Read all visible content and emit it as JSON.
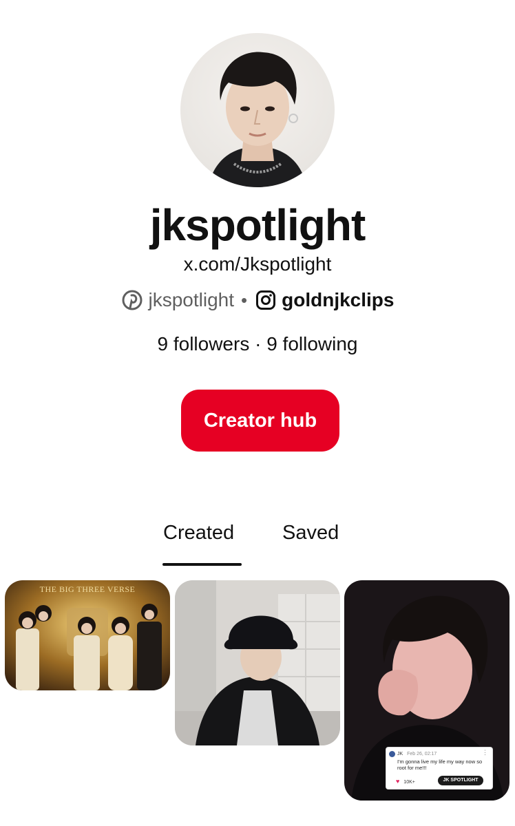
{
  "profile": {
    "username": "jkspotlight",
    "website": "x.com/Jkspotlight",
    "pinterest_handle": "jkspotlight",
    "separator": "•",
    "instagram_handle": "goldnjkclips",
    "follow_stats": "9 followers · 9 following"
  },
  "actions": {
    "creator_hub_label": "Creator hub"
  },
  "tabs": [
    {
      "label": "Created",
      "active": true
    },
    {
      "label": "Saved",
      "active": false
    }
  ],
  "pins": [
    {
      "title_text": "THE BIG THREE VERSE"
    },
    {},
    {
      "comment": {
        "author": "JK",
        "date": "Feb 26, 02:17",
        "text": "I'm gonna live my life my way now so root for me!!!",
        "likes": "10K+"
      },
      "badge": "JK SPOTLIGHT"
    }
  ],
  "colors": {
    "accent": "#e60023",
    "text_primary": "#111111",
    "text_secondary": "#5f5f5f",
    "background": "#ffffff"
  },
  "icons": {
    "pinterest": "pinterest-logo-icon",
    "instagram": "instagram-logo-icon"
  }
}
